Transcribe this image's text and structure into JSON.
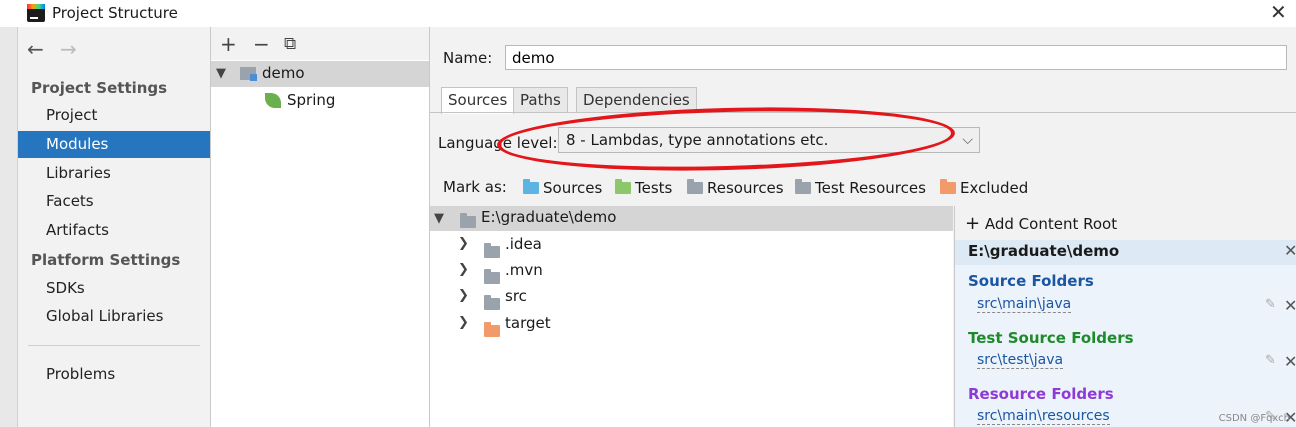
{
  "window": {
    "title": "Project Structure"
  },
  "colors": {
    "accent": "#2675bf",
    "sources": "#5db4e3",
    "tests": "#8cc86a",
    "resources": "#9aa3ab",
    "excluded": "#f19a6a",
    "selection": "#d5d5d5",
    "annotation": "#e3161b"
  },
  "nav": {
    "back_icon": "←",
    "forward_icon": "→",
    "project_settings_header": "Project Settings",
    "project_settings": [
      "Project",
      "Modules",
      "Libraries",
      "Facets",
      "Artifacts"
    ],
    "platform_settings_header": "Platform Settings",
    "platform_settings": [
      "SDKs",
      "Global Libraries"
    ],
    "problems": "Problems",
    "selected": "Modules"
  },
  "module_tree": {
    "toolbar": {
      "add": "+",
      "remove": "−",
      "copy": "⧉"
    },
    "module": "demo",
    "facet": "Spring"
  },
  "module": {
    "name_label": "Name:",
    "name_value": "demo",
    "tabs": [
      "Sources",
      "Paths",
      "Dependencies"
    ],
    "selected_tab": "Sources",
    "language_level_label": "Language level:",
    "language_level_value": "8 - Lambdas, type annotations etc.",
    "mark_as_label": "Mark as:",
    "mark_as": [
      "Sources",
      "Tests",
      "Resources",
      "Test Resources",
      "Excluded"
    ]
  },
  "content_tree": {
    "root": "E:\\graduate\\demo",
    "children": [
      ".idea",
      ".mvn",
      "src",
      "target"
    ]
  },
  "content_roots": {
    "add_label": "Add Content Root",
    "root_path": "E:\\graduate\\demo",
    "source_header": "Source Folders",
    "source_path": "src\\main\\java",
    "test_header": "Test Source Folders",
    "test_path": "src\\test\\java",
    "resource_header": "Resource Folders",
    "resource_path": "src\\main\\resources"
  },
  "watermark": "CSDN @Fqxch"
}
